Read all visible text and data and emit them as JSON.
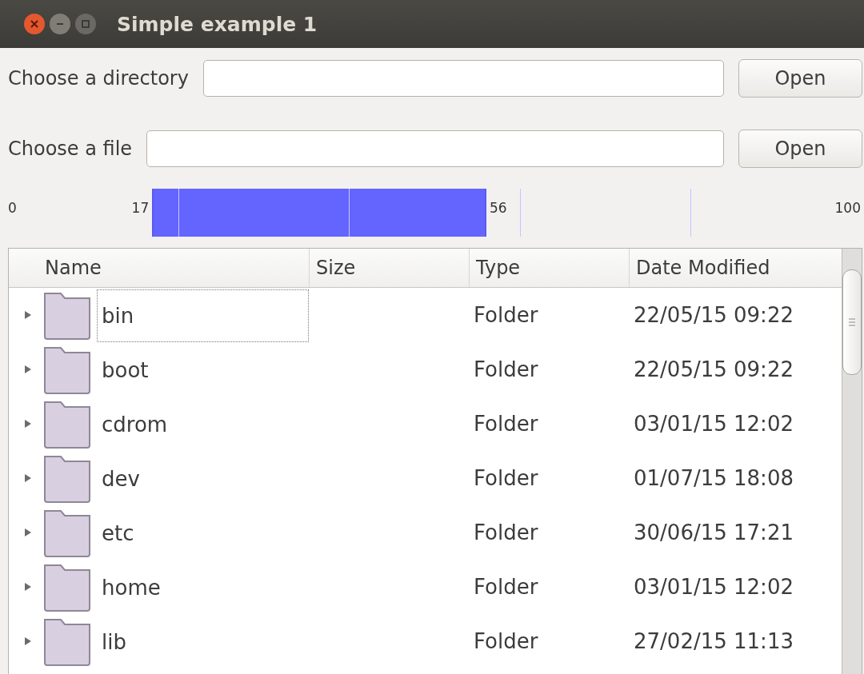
{
  "window": {
    "title": "Simple example 1"
  },
  "pickers": [
    {
      "label": "Choose a directory",
      "button": "Open"
    },
    {
      "label": "Choose a file",
      "button": "Open"
    }
  ],
  "range": {
    "min_label": "0",
    "max_label": "100",
    "low": {
      "label": "17",
      "level": 0.17
    },
    "high": {
      "label": "56",
      "level": 0.56
    }
  },
  "tree": {
    "columns": [
      "Name",
      "Size",
      "Type",
      "Date Modified"
    ],
    "rows": [
      {
        "name": "bin",
        "type": "Folder",
        "modified": "22/05/15 09:22",
        "expanded": false,
        "focused": true
      },
      {
        "name": "boot",
        "type": "Folder",
        "modified": "22/05/15 09:22",
        "expanded": false,
        "focused": false
      },
      {
        "name": "cdrom",
        "type": "Folder",
        "modified": "03/01/15 12:02",
        "expanded": false,
        "focused": false
      },
      {
        "name": "dev",
        "type": "Folder",
        "modified": "01/07/15 18:08",
        "expanded": false,
        "focused": false
      },
      {
        "name": "etc",
        "type": "Folder",
        "modified": "30/06/15 17:21",
        "expanded": false,
        "focused": false
      },
      {
        "name": "home",
        "type": "Folder",
        "modified": "03/01/15 12:02",
        "expanded": false,
        "focused": false
      },
      {
        "name": "lib",
        "type": "Folder",
        "modified": "27/02/15 11:13",
        "expanded": false,
        "focused": false
      }
    ]
  }
}
